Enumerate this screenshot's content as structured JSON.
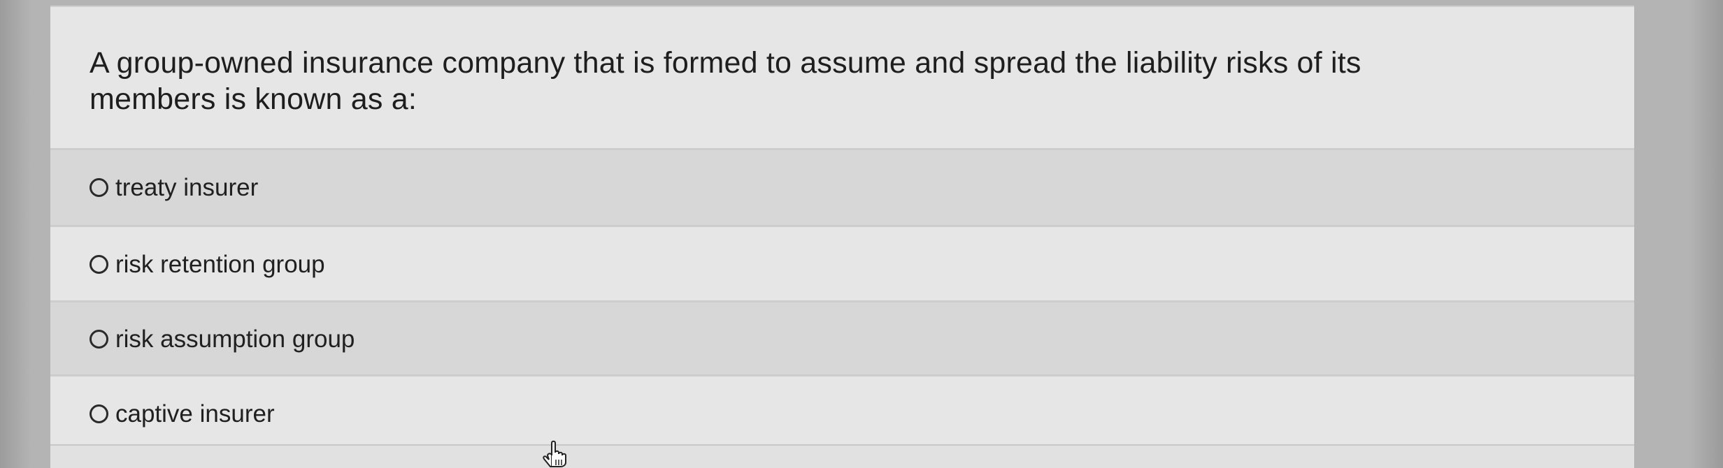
{
  "question": {
    "line1": "A group-owned insurance company that is formed to assume and spread the liability risks of its",
    "line2": "members is known as a:"
  },
  "options": [
    {
      "label": "treaty insurer",
      "selected": false
    },
    {
      "label": "risk retention group",
      "selected": false
    },
    {
      "label": "risk assumption group",
      "selected": false
    },
    {
      "label": "captive insurer",
      "selected": false
    }
  ],
  "cursor": {
    "icon": "hand-pointer-icon"
  }
}
